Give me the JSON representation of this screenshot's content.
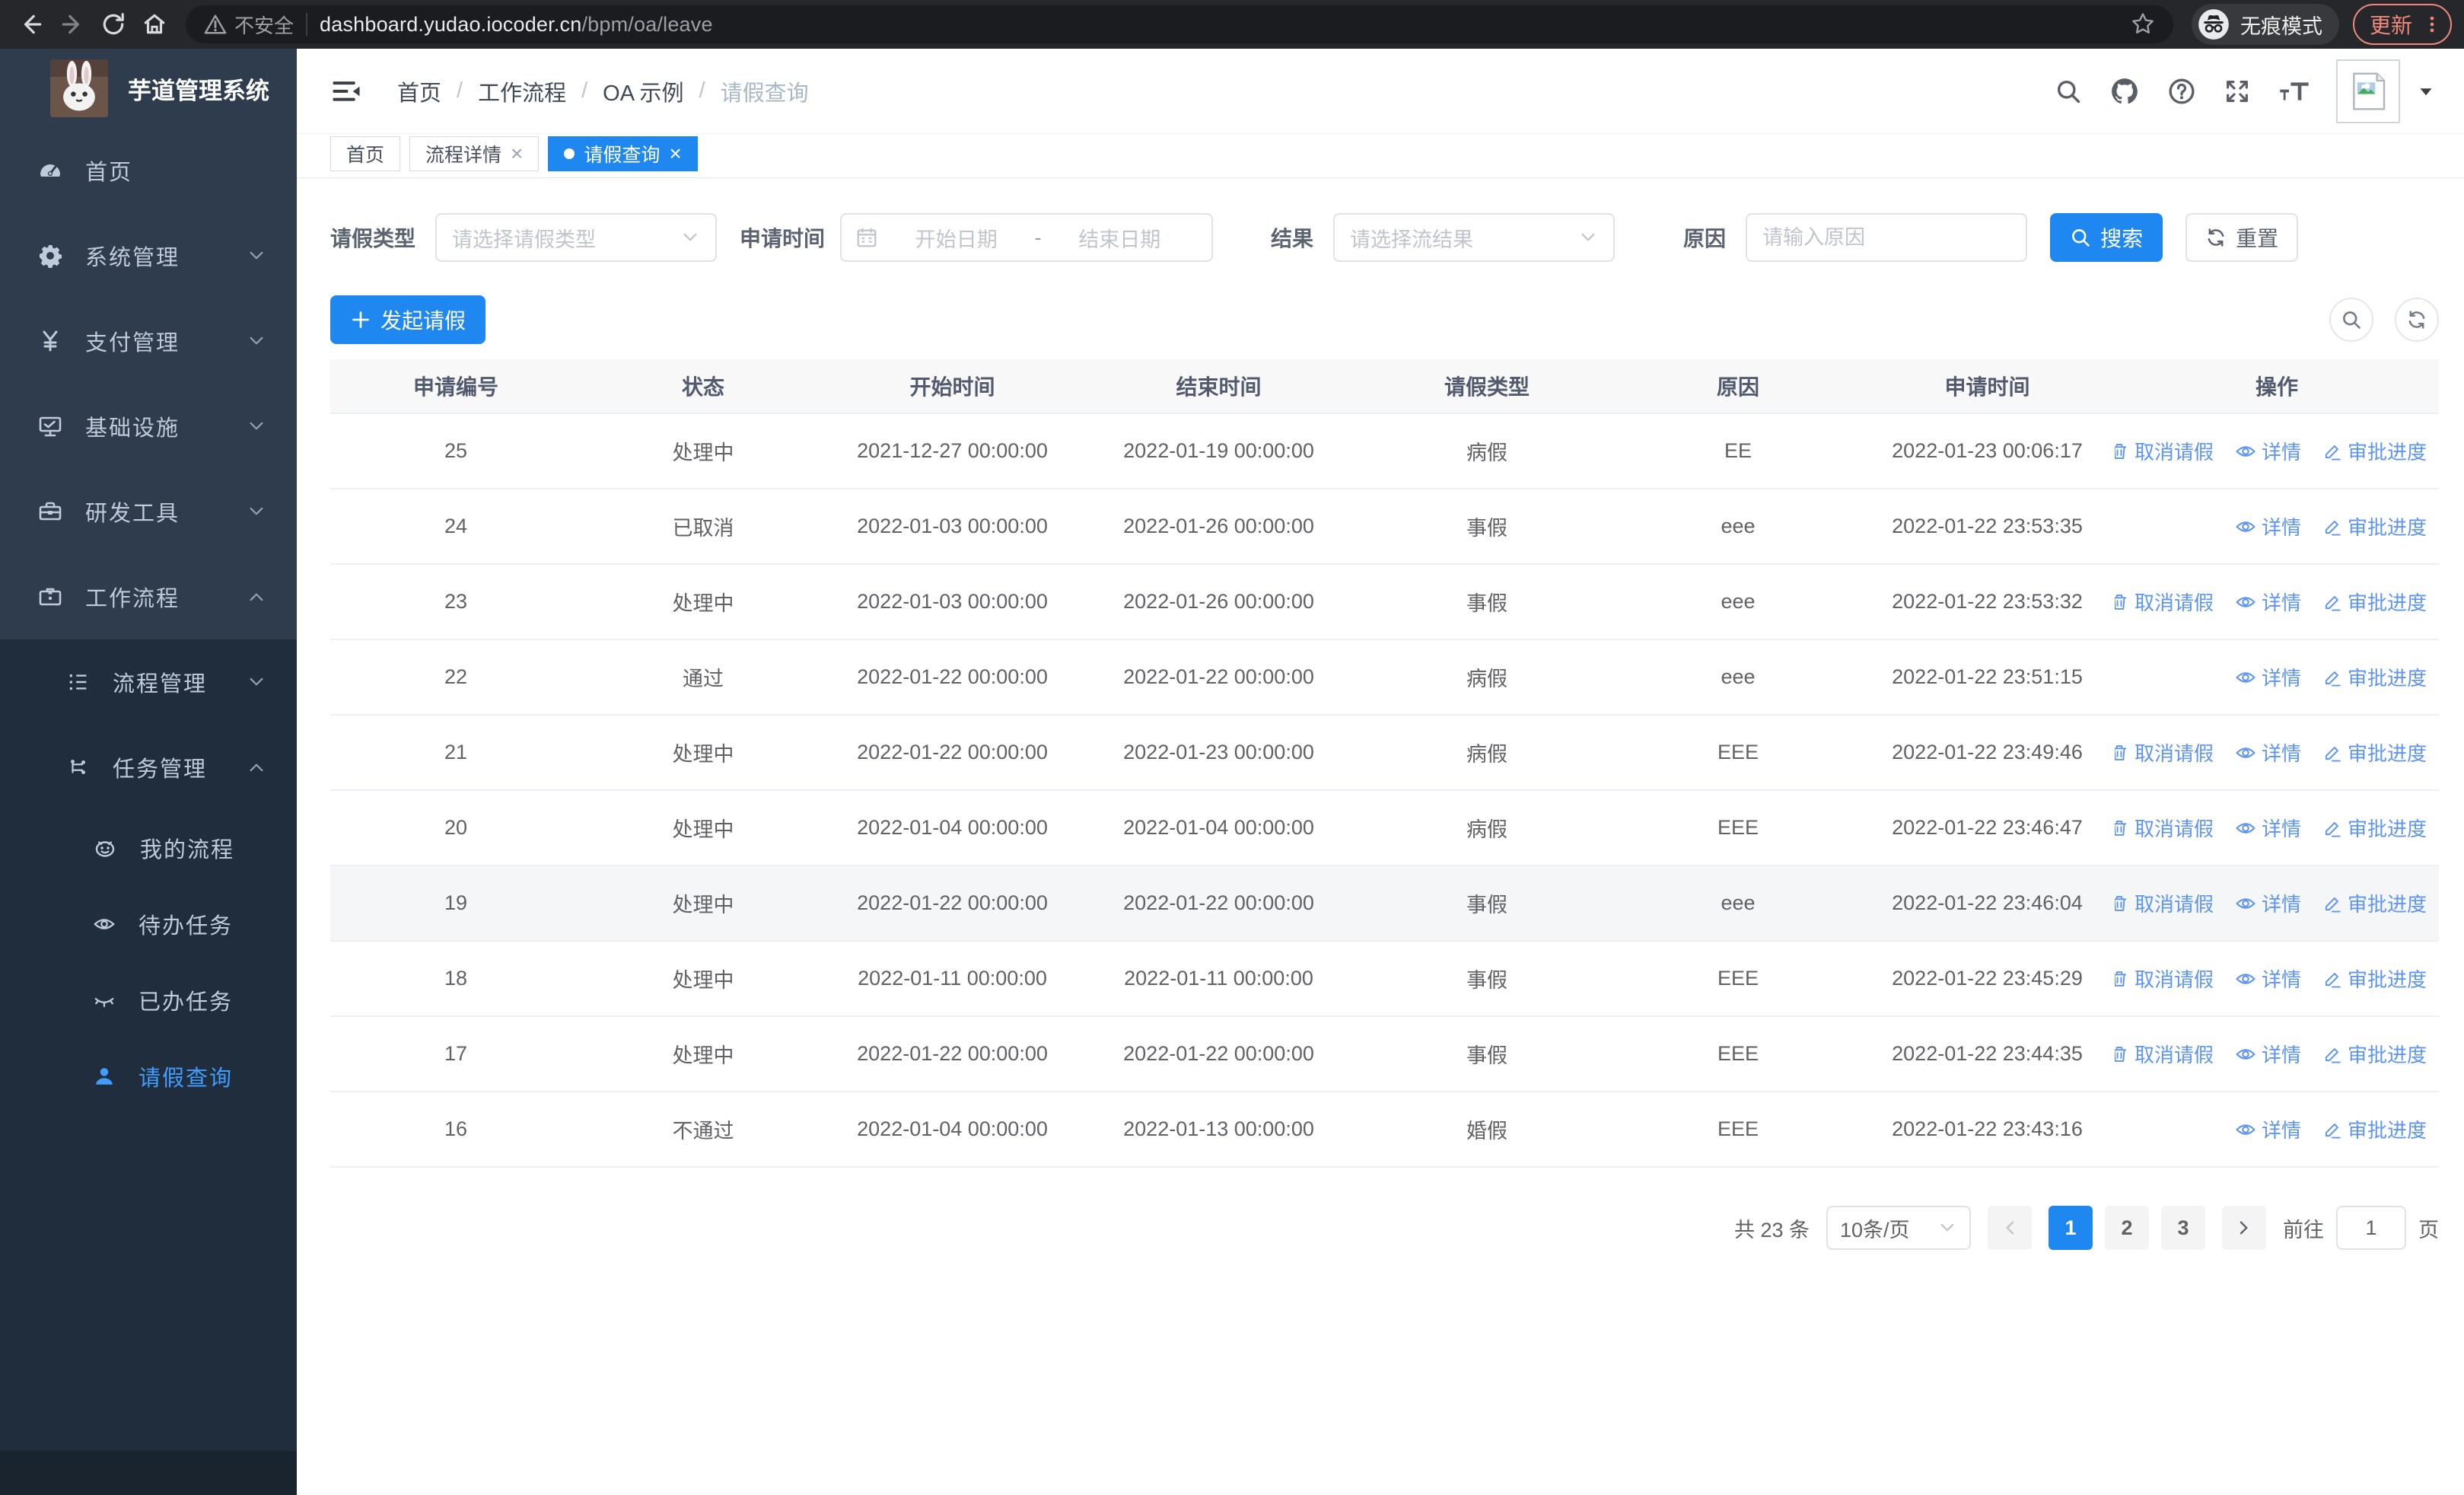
{
  "colors": {
    "primary": "#1e88f0",
    "action_link": "#5e95f2",
    "sidebar_bg": "#2f3c4e",
    "sidebar_submenu_bg": "#202d3d",
    "sidebar_active": "#409eff",
    "update_accent": "#f08879",
    "table_header_bg": "#f8f8f9"
  },
  "browser": {
    "back_icon": "back-icon",
    "forward_icon": "forward-icon",
    "reload_icon": "reload-icon",
    "home_icon": "home-icon",
    "warning_icon": "warning-icon",
    "security_label": "不安全",
    "url_host": "dashboard.yudao.iocoder.cn",
    "url_path": "/bpm/oa/leave",
    "star_icon": "star-icon",
    "incognito_icon": "incognito-icon",
    "incognito_label": "无痕模式",
    "update_label": "更新",
    "kebab_icon": "kebab-menu-icon"
  },
  "sidebar": {
    "logo_icon": "rabbit-logo",
    "title": "芋道管理系统",
    "menu": [
      {
        "name": "home",
        "label": "首页",
        "icon": "dashboard-icon",
        "level": 1
      },
      {
        "name": "system-management",
        "label": "系统管理",
        "icon": "gear-icon",
        "level": 1,
        "chevron": "down"
      },
      {
        "name": "payment-management",
        "label": "支付管理",
        "icon": "yen-icon",
        "level": 1,
        "chevron": "down"
      },
      {
        "name": "infrastructure",
        "label": "基础设施",
        "icon": "monitor-icon",
        "level": 1,
        "chevron": "down"
      },
      {
        "name": "dev-tools",
        "label": "研发工具",
        "icon": "toolbox-icon",
        "level": 1,
        "chevron": "down"
      },
      {
        "name": "workflow",
        "label": "工作流程",
        "icon": "briefcase-icon",
        "level": 1,
        "chevron": "up"
      },
      {
        "name": "process-management",
        "label": "流程管理",
        "icon": "flow-list-icon",
        "level": 2,
        "chevron": "down"
      },
      {
        "name": "task-management",
        "label": "任务管理",
        "icon": "share-nodes-icon",
        "level": 2,
        "chevron": "up"
      },
      {
        "name": "my-processes",
        "label": "我的流程",
        "icon": "face-icon",
        "level": 3
      },
      {
        "name": "todo-tasks",
        "label": "待办任务",
        "icon": "eye-open-icon",
        "level": 3
      },
      {
        "name": "done-tasks",
        "label": "已办任务",
        "icon": "eye-closed-icon",
        "level": 3
      },
      {
        "name": "leave-query",
        "label": "请假查询",
        "icon": "user-icon",
        "level": 3,
        "active": true
      }
    ]
  },
  "header": {
    "collapse_icon": "collapse-sidebar-icon",
    "breadcrumb": [
      {
        "label": "首页",
        "current": false
      },
      {
        "label": "工作流程",
        "current": false
      },
      {
        "label": "OA 示例",
        "current": false
      },
      {
        "label": "请假查询",
        "current": true
      }
    ],
    "actions": [
      {
        "name": "search",
        "icon": "search-icon"
      },
      {
        "name": "github",
        "icon": "github-icon"
      },
      {
        "name": "help",
        "icon": "help-icon"
      },
      {
        "name": "fullscreen",
        "icon": "fullscreen-icon"
      },
      {
        "name": "font-size",
        "icon": "font-size-icon"
      }
    ],
    "avatar_icon": "avatar-placeholder",
    "caret_icon": "caret-down-icon"
  },
  "tabs": [
    {
      "name": "home",
      "label": "首页",
      "closable": false,
      "active": false
    },
    {
      "name": "process-detail",
      "label": "流程详情",
      "closable": true,
      "active": false
    },
    {
      "name": "leave-query",
      "label": "请假查询",
      "closable": true,
      "active": true
    }
  ],
  "filters": {
    "leave_type": {
      "label": "请假类型",
      "placeholder": "请选择请假类型",
      "caret_icon": "chevron-down-icon"
    },
    "apply_time": {
      "label": "申请时间",
      "calendar_icon": "calendar-icon",
      "start_placeholder": "开始日期",
      "separator": "-",
      "end_placeholder": "结束日期"
    },
    "result": {
      "label": "结果",
      "placeholder": "请选择流结果",
      "caret_icon": "chevron-down-icon"
    },
    "reason": {
      "label": "原因",
      "placeholder": "请输入原因"
    },
    "search_label": "搜索",
    "search_icon": "search-icon",
    "reset_label": "重置",
    "reset_icon": "refresh-icon"
  },
  "toolbar": {
    "create_label": "发起请假",
    "create_icon": "plus-icon",
    "mini_buttons": [
      {
        "name": "table-search",
        "icon": "search-icon"
      },
      {
        "name": "table-refresh",
        "icon": "refresh-icon"
      }
    ]
  },
  "table": {
    "columns": [
      "申请编号",
      "状态",
      "开始时间",
      "结束时间",
      "请假类型",
      "原因",
      "申请时间",
      "操作"
    ],
    "action_labels": {
      "cancel": "取消请假",
      "detail": "详情",
      "progress": "审批进度"
    },
    "action_icons": {
      "cancel": "delete-icon",
      "detail": "view-icon",
      "progress": "edit-icon"
    },
    "rows": [
      {
        "id": "25",
        "status": "处理中",
        "start": "2021-12-27 00:00:00",
        "end": "2022-01-19 00:00:00",
        "type": "病假",
        "reason": "EE",
        "applied": "2022-01-23 00:06:17",
        "cancellable": true,
        "highlighted": false
      },
      {
        "id": "24",
        "status": "已取消",
        "start": "2022-01-03 00:00:00",
        "end": "2022-01-26 00:00:00",
        "type": "事假",
        "reason": "eee",
        "applied": "2022-01-22 23:53:35",
        "cancellable": false,
        "highlighted": false
      },
      {
        "id": "23",
        "status": "处理中",
        "start": "2022-01-03 00:00:00",
        "end": "2022-01-26 00:00:00",
        "type": "事假",
        "reason": "eee",
        "applied": "2022-01-22 23:53:32",
        "cancellable": true,
        "highlighted": false
      },
      {
        "id": "22",
        "status": "通过",
        "start": "2022-01-22 00:00:00",
        "end": "2022-01-22 00:00:00",
        "type": "病假",
        "reason": "eee",
        "applied": "2022-01-22 23:51:15",
        "cancellable": false,
        "highlighted": false
      },
      {
        "id": "21",
        "status": "处理中",
        "start": "2022-01-22 00:00:00",
        "end": "2022-01-23 00:00:00",
        "type": "病假",
        "reason": "EEE",
        "applied": "2022-01-22 23:49:46",
        "cancellable": true,
        "highlighted": false
      },
      {
        "id": "20",
        "status": "处理中",
        "start": "2022-01-04 00:00:00",
        "end": "2022-01-04 00:00:00",
        "type": "病假",
        "reason": "EEE",
        "applied": "2022-01-22 23:46:47",
        "cancellable": true,
        "highlighted": false
      },
      {
        "id": "19",
        "status": "处理中",
        "start": "2022-01-22 00:00:00",
        "end": "2022-01-22 00:00:00",
        "type": "事假",
        "reason": "eee",
        "applied": "2022-01-22 23:46:04",
        "cancellable": true,
        "highlighted": true
      },
      {
        "id": "18",
        "status": "处理中",
        "start": "2022-01-11 00:00:00",
        "end": "2022-01-11 00:00:00",
        "type": "事假",
        "reason": "EEE",
        "applied": "2022-01-22 23:45:29",
        "cancellable": true,
        "highlighted": false
      },
      {
        "id": "17",
        "status": "处理中",
        "start": "2022-01-22 00:00:00",
        "end": "2022-01-22 00:00:00",
        "type": "事假",
        "reason": "EEE",
        "applied": "2022-01-22 23:44:35",
        "cancellable": true,
        "highlighted": false
      },
      {
        "id": "16",
        "status": "不通过",
        "start": "2022-01-04 00:00:00",
        "end": "2022-01-13 00:00:00",
        "type": "婚假",
        "reason": "EEE",
        "applied": "2022-01-22 23:43:16",
        "cancellable": false,
        "highlighted": false
      }
    ]
  },
  "pagination": {
    "total_label": "共 23 条",
    "page_size_label": "10条/页",
    "size_caret_icon": "chevron-down-icon",
    "prev_icon": "chevron-left-icon",
    "next_icon": "chevron-right-icon",
    "pages": [
      "1",
      "2",
      "3"
    ],
    "active_page": "1",
    "goto_label": "前往",
    "goto_value": "1",
    "goto_suffix": "页"
  }
}
